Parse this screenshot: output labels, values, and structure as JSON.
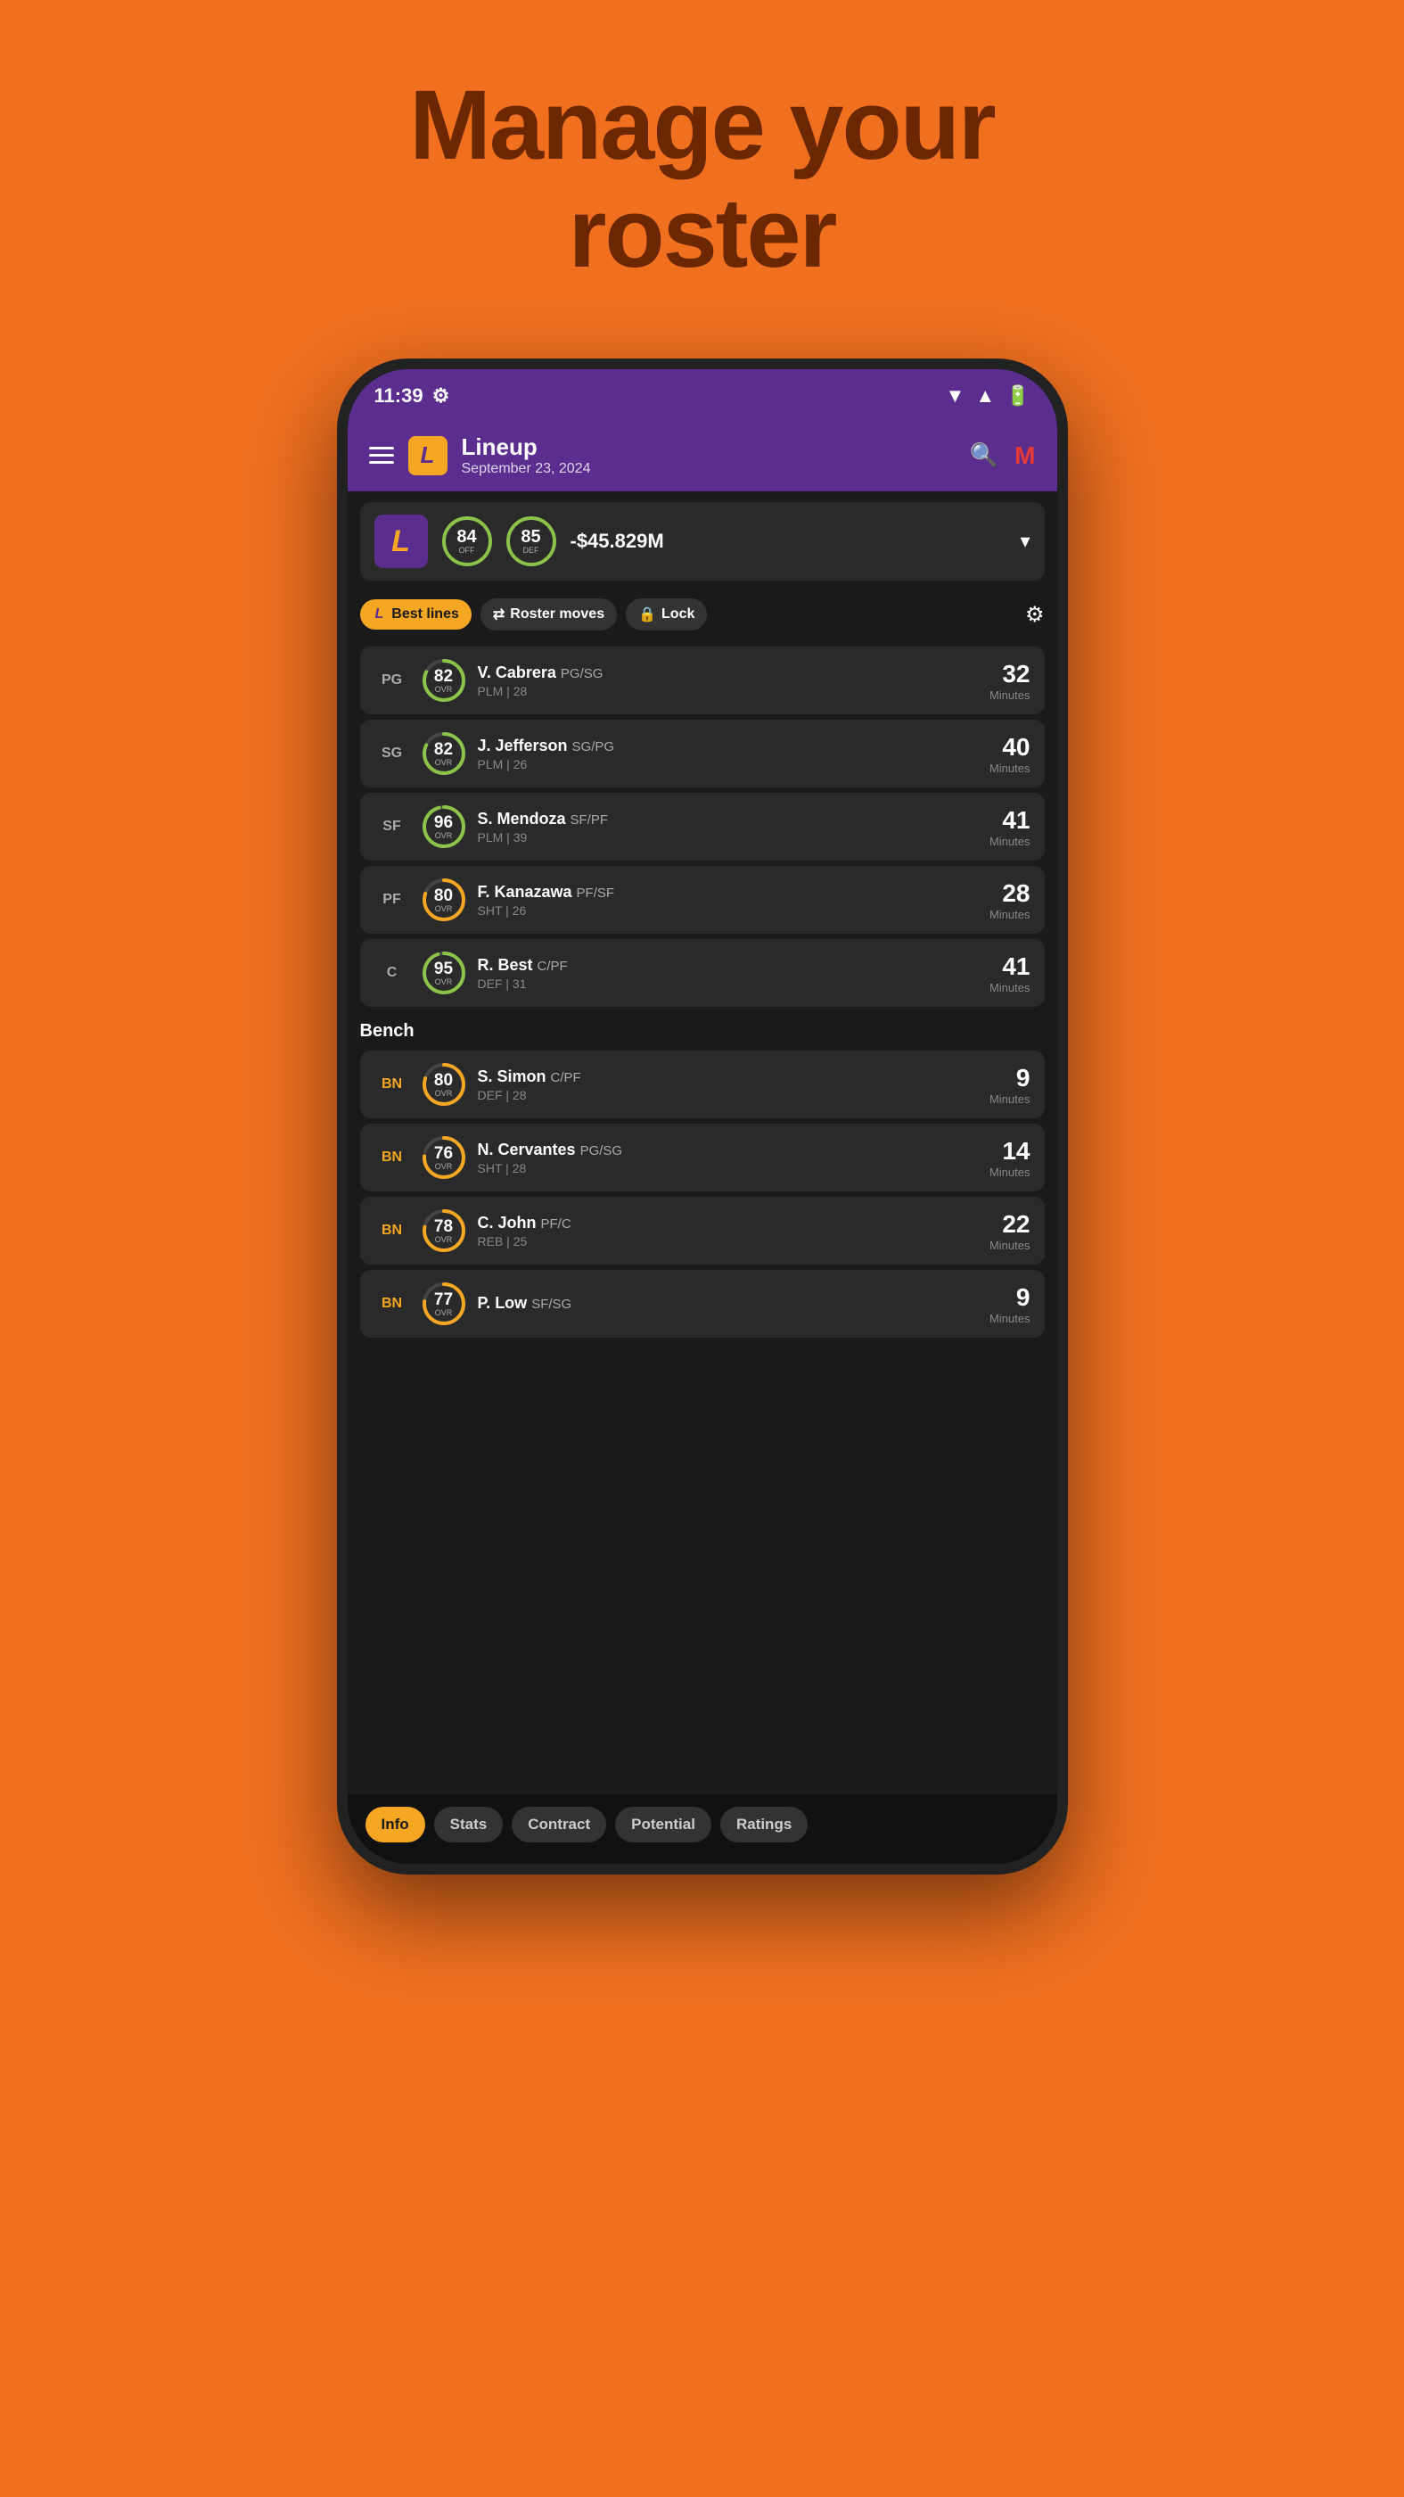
{
  "page": {
    "title_line1": "Manage your",
    "title_line2": "roster"
  },
  "status_bar": {
    "time": "11:39",
    "wifi": "▲",
    "battery": "▮"
  },
  "header": {
    "title": "Lineup",
    "subtitle": "September 23, 2024",
    "logo_letter": "L",
    "search_label": "🔍",
    "m_label": "M"
  },
  "team_summary": {
    "logo_letter": "L",
    "off_rating": "84",
    "off_label": "OFF",
    "def_rating": "85",
    "def_label": "DEF",
    "money": "-$45.829M"
  },
  "action_bar": {
    "best_lines": "Best lines",
    "roster_moves": "Roster moves",
    "lock": "Lock"
  },
  "starters": [
    {
      "position": "PG",
      "ovr": "82",
      "name": "V. Cabrera",
      "pos_detail": "PG/SG",
      "sub": "PLM | 28",
      "minutes": "32",
      "ring_color": "#8BC34A"
    },
    {
      "position": "SG",
      "ovr": "82",
      "name": "J. Jefferson",
      "pos_detail": "SG/PG",
      "sub": "PLM | 26",
      "minutes": "40",
      "ring_color": "#8BC34A"
    },
    {
      "position": "SF",
      "ovr": "96",
      "name": "S. Mendoza",
      "pos_detail": "SF/PF",
      "sub": "PLM | 39",
      "minutes": "41",
      "ring_color": "#8BC34A"
    },
    {
      "position": "PF",
      "ovr": "80",
      "name": "F. Kanazawa",
      "pos_detail": "PF/SF",
      "sub": "SHT | 26",
      "minutes": "28",
      "ring_color": "#F5A623"
    },
    {
      "position": "C",
      "ovr": "95",
      "name": "R. Best",
      "pos_detail": "C/PF",
      "sub": "DEF | 31",
      "minutes": "41",
      "ring_color": "#8BC34A"
    }
  ],
  "bench_label": "Bench",
  "bench": [
    {
      "position": "BN",
      "ovr": "80",
      "name": "S. Simon",
      "pos_detail": "C/PF",
      "sub": "DEF | 28",
      "minutes": "9",
      "ring_color": "#F5A623"
    },
    {
      "position": "BN",
      "ovr": "76",
      "name": "N. Cervantes",
      "pos_detail": "PG/SG",
      "sub": "SHT | 28",
      "minutes": "14",
      "ring_color": "#F5A623"
    },
    {
      "position": "BN",
      "ovr": "78",
      "name": "C. John",
      "pos_detail": "PF/C",
      "sub": "REB | 25",
      "minutes": "22",
      "ring_color": "#F5A623"
    },
    {
      "position": "BN",
      "ovr": "77",
      "name": "P. Low",
      "pos_detail": "SF/SG",
      "sub": "",
      "minutes": "9",
      "ring_color": "#F5A623"
    }
  ],
  "bottom_tabs": [
    {
      "label": "Info",
      "active": true
    },
    {
      "label": "Stats",
      "active": false
    },
    {
      "label": "Contract",
      "active": false
    },
    {
      "label": "Potential",
      "active": false
    },
    {
      "label": "Ratings",
      "active": false
    }
  ]
}
